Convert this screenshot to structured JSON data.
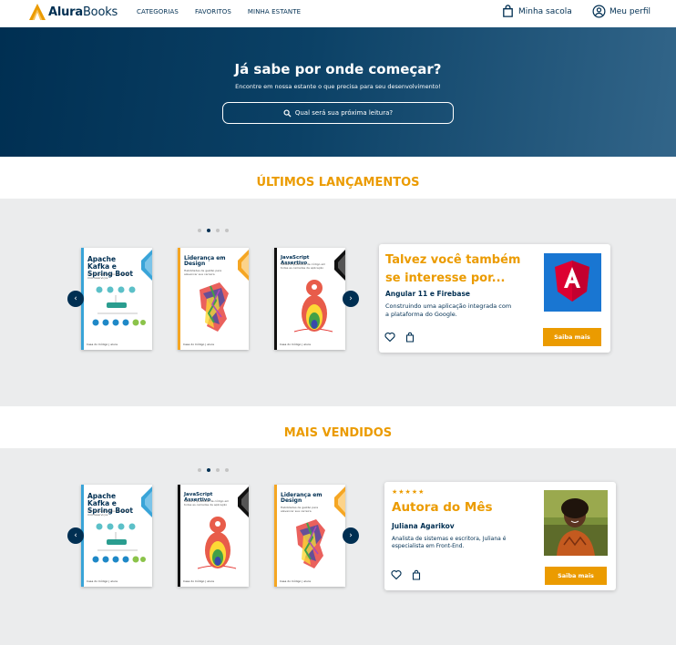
{
  "header": {
    "logo_brand": "Alura",
    "logo_suffix": "Books",
    "nav": [
      "CATEGORIAS",
      "FAVORITOS",
      "MINHA ESTANTE"
    ],
    "bag_label": "Minha sacola",
    "profile_label": "Meu perfil"
  },
  "hero": {
    "title": "Já sabe por onde começar?",
    "subtitle": "Encontre em nossa estante o que precisa para seu desenvolvimento!",
    "search_placeholder": "Qual será sua próxima leitura?"
  },
  "launches": {
    "title": "ÚLTIMOS LANÇAMENTOS",
    "carousel_active_page": 2,
    "carousel_pages": 4,
    "books": [
      {
        "title": "Apache Kafka e Spring Boot",
        "subtitle": "Comunicação assíncrona entre microsserviços",
        "accent": "#39a4d8"
      },
      {
        "title": "Liderança em Design",
        "subtitle": "Habilidades de gestão para alavancar sua carreira",
        "accent": "#f5a623"
      },
      {
        "title": "JavaScript Assertivo",
        "subtitle": "Testes e qualidade de código em todas as camadas da aplicação",
        "accent": "#111111"
      }
    ],
    "card": {
      "title": "Talvez você também se interesse por...",
      "book_title": "Angular 11 e Firebase",
      "description": "Construindo uma aplicação integrada com a plataforma do Google.",
      "button": "Saiba mais"
    }
  },
  "bestsellers": {
    "title": "MAIS VENDIDOS",
    "carousel_active_page": 2,
    "carousel_pages": 4,
    "books": [
      {
        "title": "Apache Kafka e Spring Boot",
        "subtitle": "Comunicação assíncrona entre microsserviços",
        "accent": "#39a4d8"
      },
      {
        "title": "JavaScript Assertivo",
        "subtitle": "Testes e qualidade de código em todas as camadas da aplicação",
        "accent": "#111111"
      },
      {
        "title": "Liderança em Design",
        "subtitle": "Habilidades de gestão para alavancar sua carreira",
        "accent": "#f5a623"
      }
    ],
    "card": {
      "stars": "★★★★★",
      "title": "Autora do Mês",
      "author_name": "Juliana Agarikov",
      "description": "Analista de sistemas e escritora, Juliana é especialista em Front-End.",
      "button": "Saiba mais"
    }
  },
  "book_footer": "Casa do Código | alura",
  "colors": {
    "navy": "#002f52",
    "orange": "#eb9b00",
    "page_bg": "#ebeced"
  }
}
